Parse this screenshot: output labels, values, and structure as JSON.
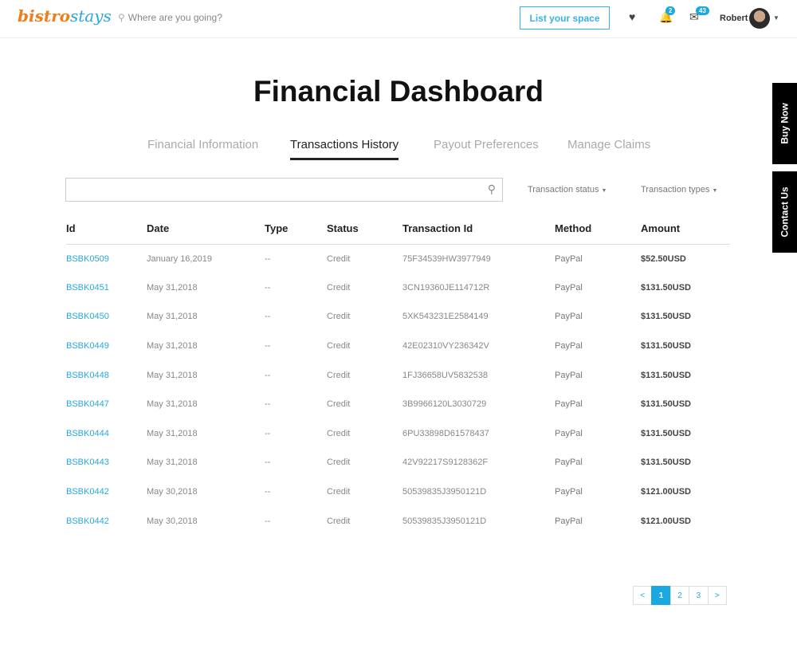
{
  "header": {
    "logo_a": "bistro",
    "logo_b": "stays",
    "search_placeholder": "Where are you going?",
    "list_space": "List your space",
    "notif_count": "2",
    "msg_count": "43",
    "user_name": "Robert"
  },
  "page_title": "Financial Dashboard",
  "tabs": [
    {
      "label": "Financial Information"
    },
    {
      "label": "Transactions History",
      "active": true
    },
    {
      "label": "Payout Preferences"
    },
    {
      "label": "Manage Claims"
    }
  ],
  "filters": {
    "status": "Transaction status",
    "types": "Transaction types"
  },
  "table": {
    "columns": [
      "Id",
      "Date",
      "Type",
      "Status",
      "Transaction Id",
      "Method",
      "Amount"
    ],
    "rows": [
      [
        "BSBK0509",
        "January 16,2019",
        "--",
        "Credit",
        "75F34539HW3977949",
        "PayPal",
        "$52.50USD"
      ],
      [
        "BSBK0451",
        "May 31,2018",
        "--",
        "Credit",
        "3CN19360JE114712R",
        "PayPal",
        "$131.50USD"
      ],
      [
        "BSBK0450",
        "May 31,2018",
        "--",
        "Credit",
        "5XK543231E2584149",
        "PayPal",
        "$131.50USD"
      ],
      [
        "BSBK0449",
        "May 31,2018",
        "--",
        "Credit",
        "42E02310VY236342V",
        "PayPal",
        "$131.50USD"
      ],
      [
        "BSBK0448",
        "May 31,2018",
        "--",
        "Credit",
        "1FJ36658UV5832538",
        "PayPal",
        "$131.50USD"
      ],
      [
        "BSBK0447",
        "May 31,2018",
        "--",
        "Credit",
        "3B9966120L3030729",
        "PayPal",
        "$131.50USD"
      ],
      [
        "BSBK0444",
        "May 31,2018",
        "--",
        "Credit",
        "6PU33898D61578437",
        "PayPal",
        "$131.50USD"
      ],
      [
        "BSBK0443",
        "May 31,2018",
        "--",
        "Credit",
        "42V92217S9128362F",
        "PayPal",
        "$131.50USD"
      ],
      [
        "BSBK0442",
        "May 30,2018",
        "--",
        "Credit",
        "50539835J3950121D",
        "PayPal",
        "$121.00USD"
      ],
      [
        "BSBK0442",
        "May 30,2018",
        "--",
        "Credit",
        "50539835J3950121D",
        "PayPal",
        "$121.00USD"
      ]
    ]
  },
  "pagination": {
    "prev": "<",
    "pages": [
      "1",
      "2",
      "3"
    ],
    "current": "1",
    "next": ">"
  },
  "side": {
    "buy_now": "Buy Now",
    "contact_us": "Contact Us"
  },
  "colors": {
    "accent": "#1aa8e0",
    "logo_orange": "#f07d1a"
  }
}
